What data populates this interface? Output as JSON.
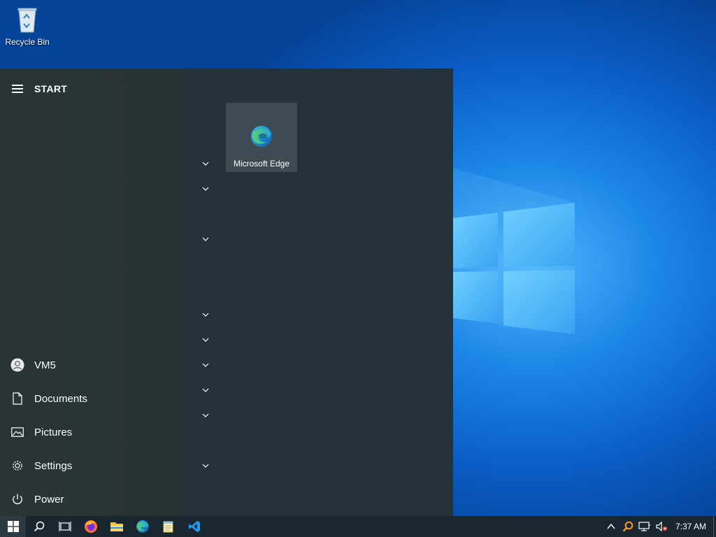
{
  "desktop": {
    "icons": [
      {
        "label": "Recycle Bin",
        "icon": "recycle-bin-icon"
      }
    ]
  },
  "start_menu": {
    "title": "START",
    "side_items": [
      {
        "label": "VM5",
        "icon": "user-avatar-icon"
      },
      {
        "label": "Documents",
        "icon": "document-icon"
      },
      {
        "label": "Pictures",
        "icon": "pictures-icon"
      },
      {
        "label": "Settings",
        "icon": "gear-icon"
      },
      {
        "label": "Power",
        "icon": "power-icon"
      }
    ],
    "tiles": [
      {
        "label": "Microsoft Edge",
        "icon": "edge-icon"
      }
    ],
    "group_chevron_icon": "chevron-down-icon"
  },
  "taskbar": {
    "apps": [
      "windows-start-icon",
      "search-icon",
      "task-view-icon",
      "firefox-icon",
      "file-explorer-icon",
      "edge-icon",
      "notepad-icon",
      "vscode-icon"
    ],
    "tray": [
      "chevron-up-icon",
      "search-tool-icon",
      "network-icon",
      "volume-muted-icon"
    ],
    "clock": "7:37 AM"
  },
  "colors": {
    "start_menu_bg": "#24323a",
    "taskbar_bg": "#1a2730",
    "desktop_accent": "#1c86e6",
    "tile_bg": "#3f4b52"
  }
}
